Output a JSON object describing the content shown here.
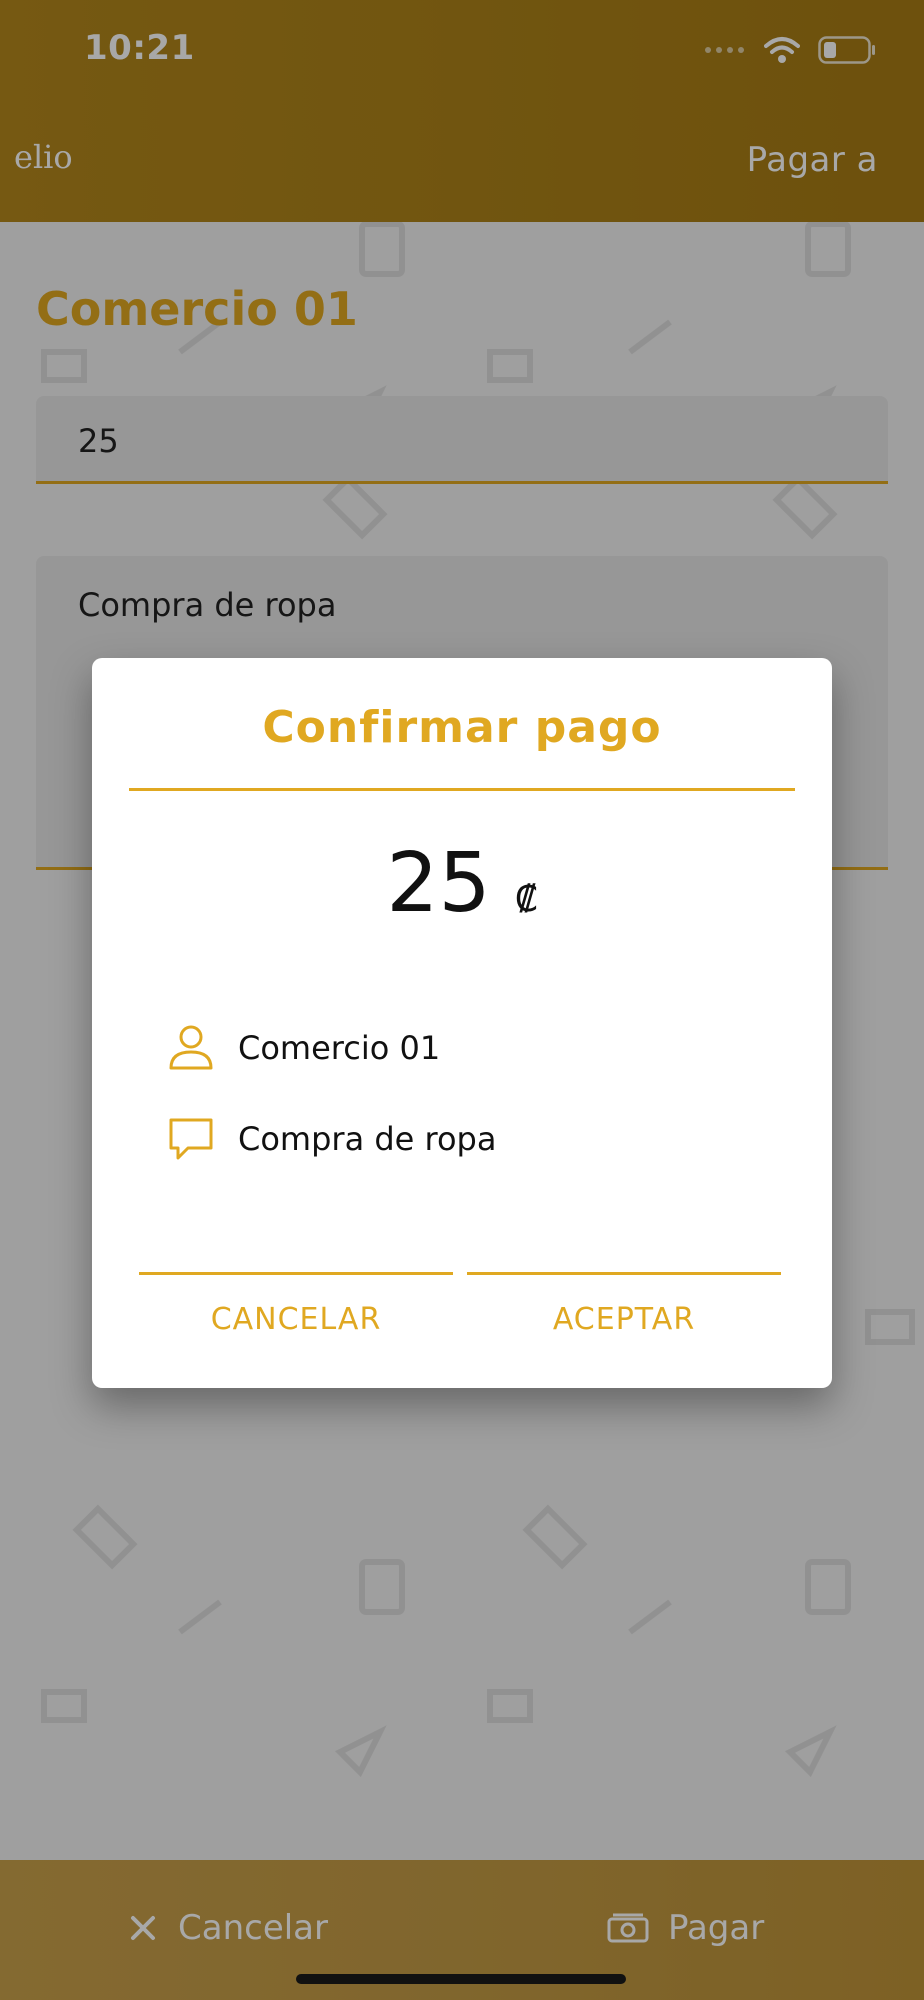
{
  "status_bar": {
    "time": "10:21"
  },
  "header": {
    "logo_text": "elio",
    "title": "Pagar a"
  },
  "form": {
    "merchant_name": "Comercio 01",
    "amount_value": "25",
    "description_value": "Compra de ropa"
  },
  "bottom_bar": {
    "cancel_label": "Cancelar",
    "pay_label": "Pagar"
  },
  "dialog": {
    "title": "Confirmar pago",
    "amount": "25",
    "currency_symbol": "₡",
    "merchant": "Comercio 01",
    "description": "Compra de ropa",
    "cancel_label": "CANCELAR",
    "accept_label": "ACEPTAR"
  },
  "colors": {
    "accent": "#e0a821",
    "header": "#ae841a"
  },
  "icons": [
    "wifi-icon",
    "battery-icon",
    "user-icon",
    "chat-icon",
    "close-icon",
    "cash-icon"
  ]
}
